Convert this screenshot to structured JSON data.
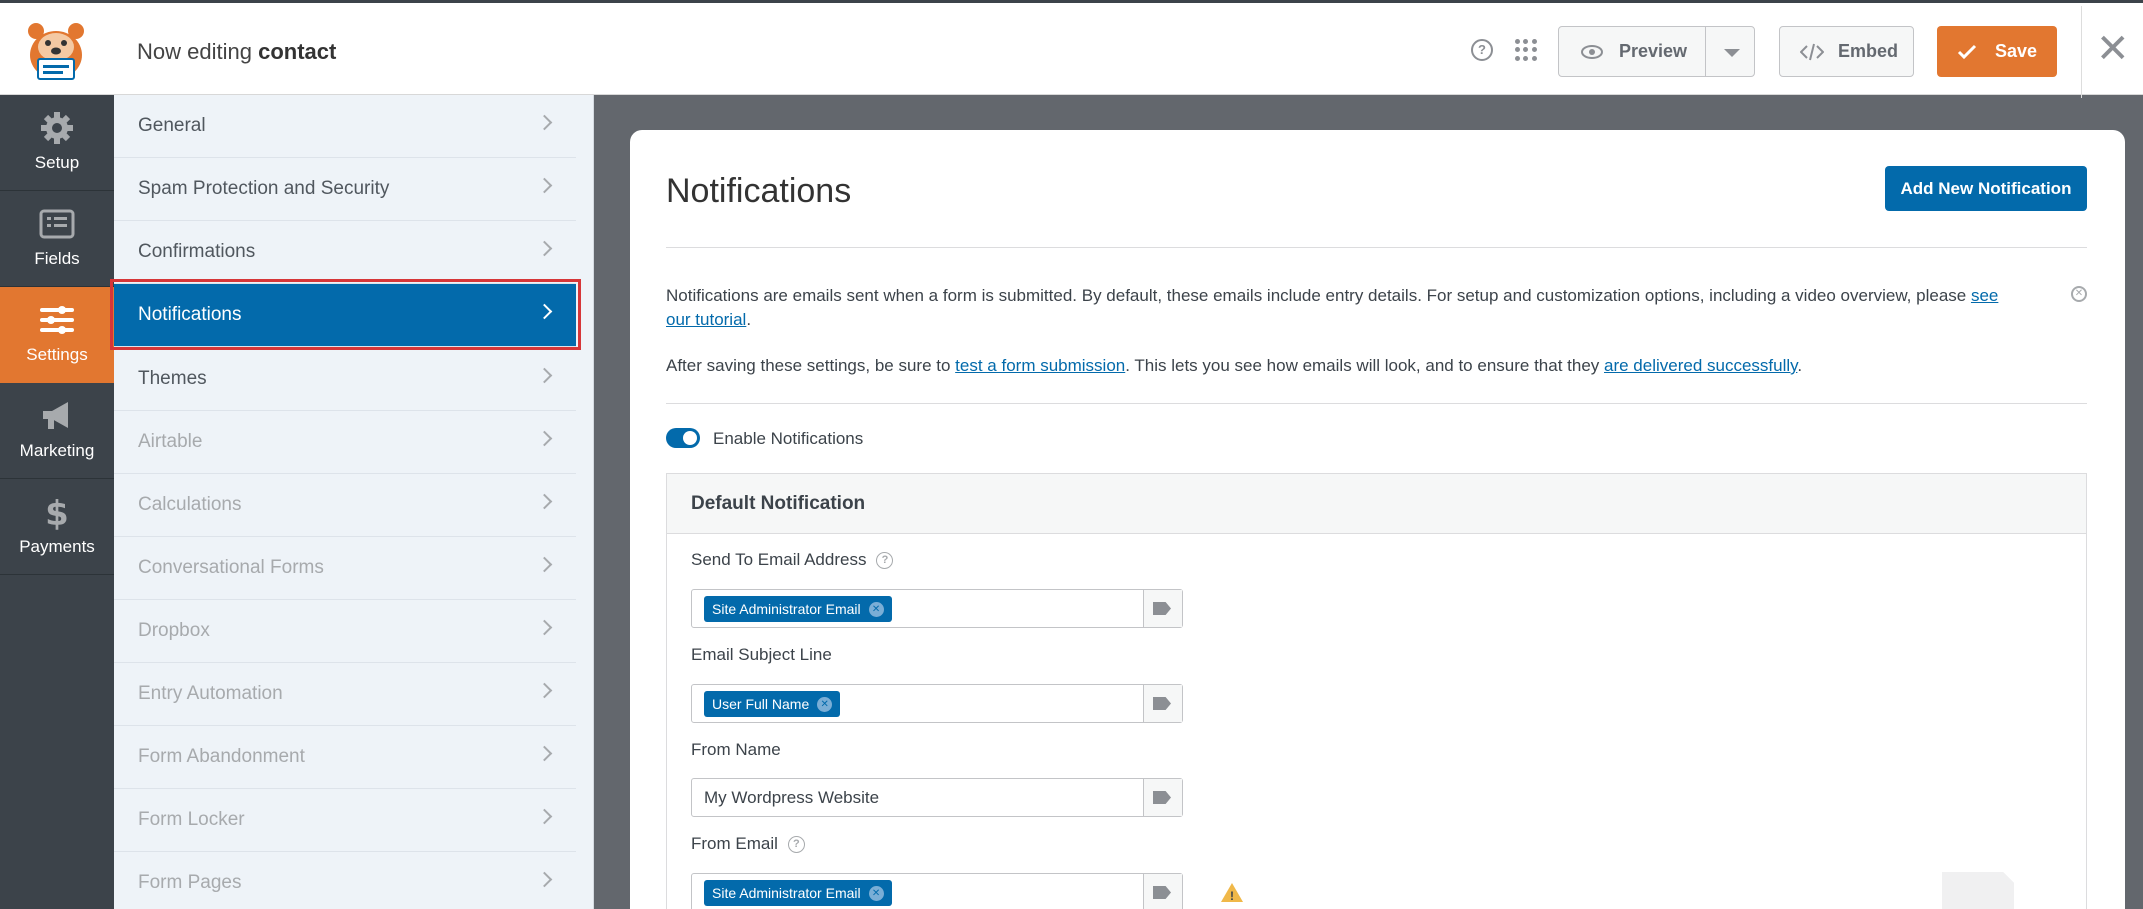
{
  "header": {
    "title_prefix": "Now editing",
    "form_name": "contact",
    "preview_label": "Preview",
    "embed_label": "Embed",
    "save_label": "Save"
  },
  "leftnav": {
    "items": [
      {
        "label": "Setup",
        "icon": "gear-icon",
        "active": false
      },
      {
        "label": "Fields",
        "icon": "list-icon",
        "active": false
      },
      {
        "label": "Settings",
        "icon": "sliders-icon",
        "active": true
      },
      {
        "label": "Marketing",
        "icon": "megaphone-icon",
        "active": false
      },
      {
        "label": "Payments",
        "icon": "dollar-icon",
        "active": false
      }
    ]
  },
  "settings_panel": {
    "items": [
      {
        "label": "General"
      },
      {
        "label": "Spam Protection and Security"
      },
      {
        "label": "Confirmations"
      },
      {
        "label": "Notifications"
      },
      {
        "label": "Themes"
      },
      {
        "label": "Airtable"
      },
      {
        "label": "Calculations"
      },
      {
        "label": "Conversational Forms"
      },
      {
        "label": "Dropbox"
      },
      {
        "label": "Entry Automation"
      },
      {
        "label": "Form Abandonment"
      },
      {
        "label": "Form Locker"
      },
      {
        "label": "Form Pages"
      }
    ]
  },
  "main": {
    "title": "Notifications",
    "add_button": "Add New Notification",
    "notice_text": "Notifications are emails sent when a form is submitted. By default, these emails include entry details. For setup and customization options, including a video overview, please ",
    "notice_link": "see our tutorial",
    "note2_prefix": "After saving these settings, be sure to ",
    "note2_link1": "test a form submission",
    "note2_middle": ". This lets you see how emails will look, and to ensure that they ",
    "note2_link2": "are delivered successfully",
    "toggle_label": "Enable Notifications",
    "box_title": "Default Notification",
    "fields": {
      "send_to_label": "Send To Email Address",
      "send_to_chip": "Site Administrator Email",
      "subject_label": "Email Subject Line",
      "subject_chip": "User Full Name",
      "from_name_label": "From Name",
      "from_name_value": "My Wordpress Website",
      "from_email_label": "From Email",
      "from_email_chip": "Site Administrator Email"
    }
  }
}
